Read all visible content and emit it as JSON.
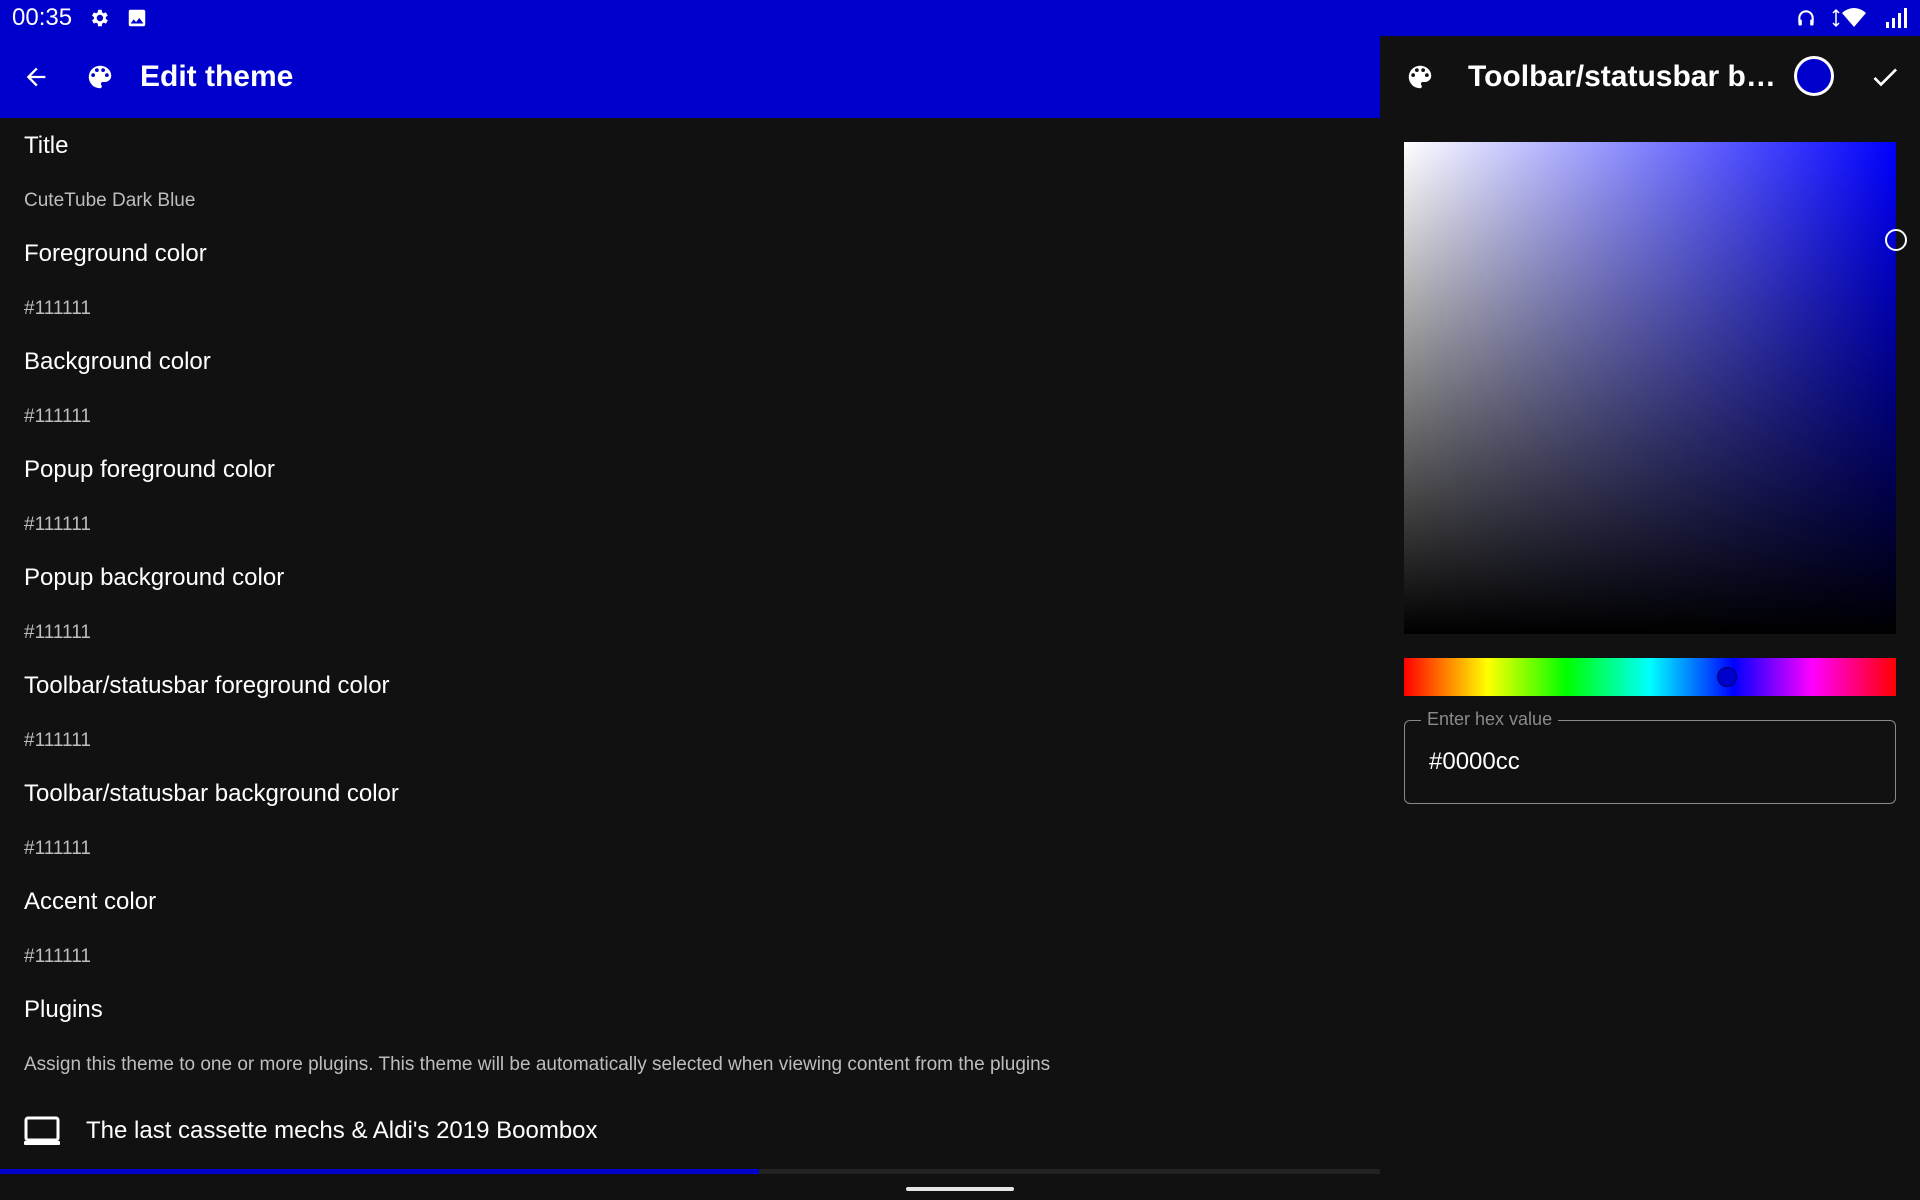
{
  "status_bar": {
    "time": "00:35",
    "left_icons": [
      "settings-icon",
      "image-icon"
    ],
    "right_icons": [
      "headphones-icon",
      "wifi-icon",
      "signal-icon"
    ]
  },
  "toolbar": {
    "title": "Edit theme",
    "background": "#0000cc"
  },
  "list": {
    "items": [
      {
        "title": "Title",
        "subtitle": "CuteTube Dark Blue"
      },
      {
        "title": "Foreground color",
        "subtitle": "#111111"
      },
      {
        "title": "Background color",
        "subtitle": "#111111"
      },
      {
        "title": "Popup foreground color",
        "subtitle": "#111111"
      },
      {
        "title": "Popup background color",
        "subtitle": "#111111"
      },
      {
        "title": "Toolbar/statusbar foreground color",
        "subtitle": "#111111"
      },
      {
        "title": "Toolbar/statusbar background color",
        "subtitle": "#111111"
      },
      {
        "title": "Accent color",
        "subtitle": "#111111"
      },
      {
        "title": "Plugins",
        "subtitle": "Assign this theme to one or more plugins. This theme will be automatically selected when viewing content from the plugins"
      }
    ],
    "plugin": {
      "label": "The last cassette mechs & Aldi's 2019 Boombox",
      "icon": "laptop-icon"
    }
  },
  "progress": {
    "value_percent": 55
  },
  "color_dialog": {
    "title": "Toolbar/statusbar bac...",
    "selected_color": "#0000cc",
    "hex_label": "Enter hex value",
    "hex_value": "#0000cc",
    "hue_color": "#0000ff"
  }
}
